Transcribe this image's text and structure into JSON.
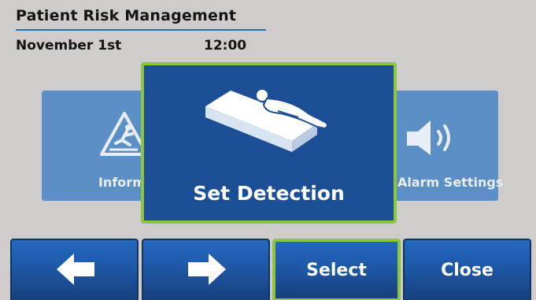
{
  "header": {
    "title": "Patient Risk Management",
    "date": "November 1st",
    "time": "12:00"
  },
  "carousel": {
    "left_card_label": "Information",
    "left_card_icon": "fall-warning-icon",
    "center_card_label": "Set Detection",
    "center_card_icon": "patient-bed-icon",
    "right_card_label": "Alarm Settings",
    "right_card_icon": "speaker-icon"
  },
  "buttons": {
    "previous_icon": "arrow-left-icon",
    "next_icon": "arrow-right-icon",
    "select_label": "Select",
    "close_label": "Close"
  },
  "colors": {
    "background": "#cecdcb",
    "primary_blue": "#1b4e94",
    "side_card_blue": "#5b8fc5",
    "focus_green": "#8cc63f",
    "title_rule": "#2a6cb5"
  }
}
